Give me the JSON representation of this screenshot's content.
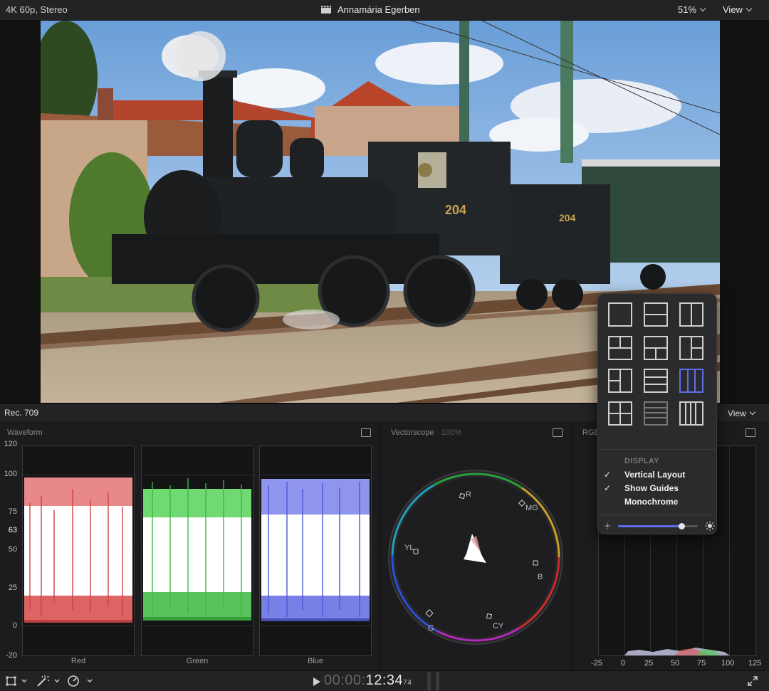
{
  "topbar": {
    "format_label": "4K 60p, Stereo",
    "clip_title": "Annamária Egerben",
    "zoom_label": "51%",
    "view_label": "View",
    "clapper_icon": "clapperboard-icon"
  },
  "scopes_header": {
    "color_standard": "Rec. 709",
    "view_label": "View"
  },
  "waveform": {
    "title": "Waveform",
    "y_ticks": [
      "120",
      "100",
      "75",
      "63",
      "50",
      "25",
      "0",
      "-20"
    ],
    "channels": [
      "Red",
      "Green",
      "Blue"
    ],
    "channel_colors": [
      "#e05050",
      "#45d24a",
      "#5a60e0"
    ]
  },
  "vectorscope": {
    "title": "Vectorscope",
    "zoom": "100%",
    "targets": [
      "R",
      "MG",
      "B",
      "CY",
      "G",
      "YL"
    ]
  },
  "histogram": {
    "title": "RGB",
    "x_ticks": [
      "-25",
      "0",
      "25",
      "50",
      "75",
      "100",
      "125"
    ]
  },
  "popover": {
    "section_label": "DISPLAY",
    "items": [
      {
        "label": "Vertical Layout",
        "checked": "✓"
      },
      {
        "label": "Show Guides",
        "checked": "✓"
      },
      {
        "label": "Monochrome",
        "checked": ""
      }
    ],
    "brightness": 0.8,
    "selected_layout": 9
  },
  "bottombar": {
    "timecode_dim": "00:00:",
    "timecode_lit": "12:34",
    "timecode_frames": "74"
  },
  "colors": {
    "accent": "#5b6ee8",
    "panel": "#1c1c1e",
    "bar": "#232325"
  }
}
